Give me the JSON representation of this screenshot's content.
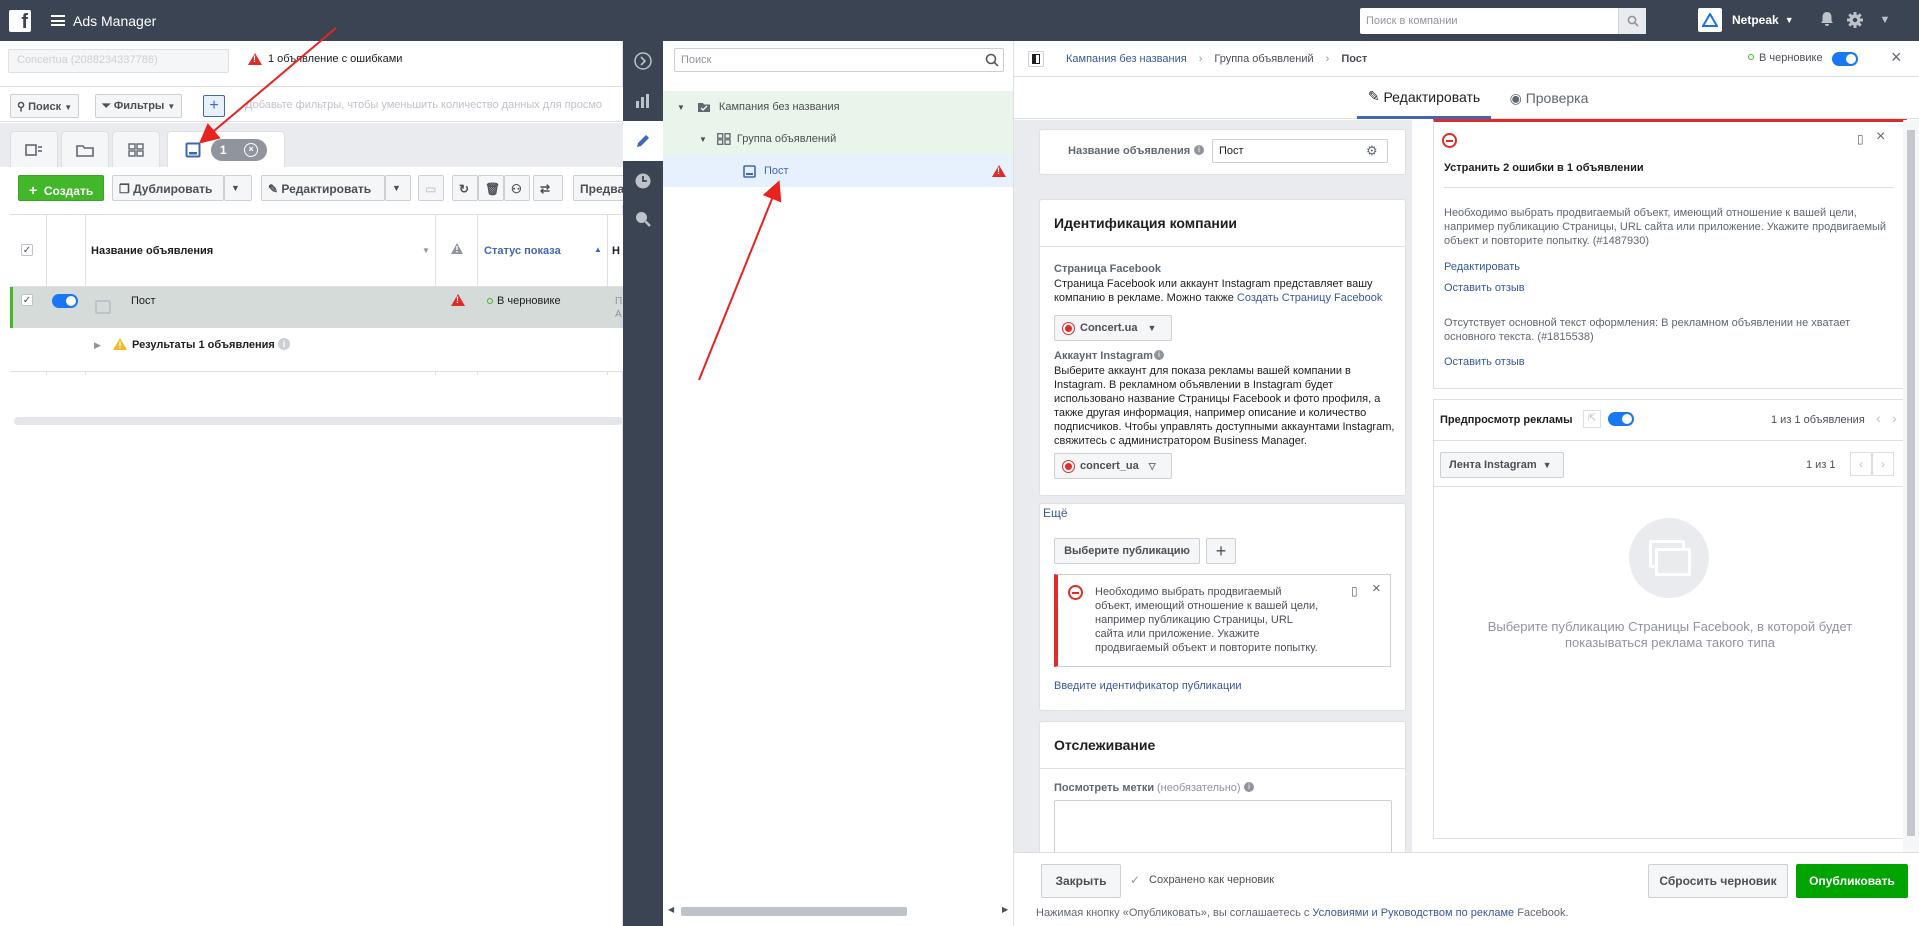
{
  "topbar": {
    "app_title": "Ads Manager",
    "search_placeholder": "Поиск в компании",
    "account_name": "Netpeak"
  },
  "left": {
    "account_selector": "Concertua (2088234337786)",
    "error_summary": "1 объявление с ошибками",
    "filters": {
      "search_label": "Поиск",
      "filters_label": "Фильтры",
      "placeholder": "Добавьте фильтры, чтобы уменьшить количество данных для просмо"
    },
    "selected_count": "1",
    "actions": {
      "create": "Создать",
      "duplicate": "Дублировать",
      "edit": "Редактировать",
      "preview": "Предва"
    },
    "table": {
      "headers": {
        "name": "Название объявления",
        "status": "Статус показа",
        "next": "Н"
      },
      "rows": [
        {
          "name": "Пост",
          "status": "В черновике",
          "next": "П А"
        }
      ],
      "results": "Результаты 1 объявления"
    }
  },
  "tree": {
    "search_placeholder": "Поиск",
    "campaign": "Кампания без названия",
    "adset": "Группа объявлений",
    "ad": "Пост"
  },
  "editor": {
    "breadcrumb": {
      "campaign": "Кампания без названия",
      "adset": "Группа объявлений",
      "ad": "Пост"
    },
    "draft_status": "В черновике",
    "tabs": {
      "edit": "Редактировать",
      "review": "Проверка"
    },
    "ad_name": {
      "label": "Название объявления",
      "value": "Пост"
    },
    "identity": {
      "title": "Идентификация компании",
      "fb_label": "Страница Facebook",
      "fb_text": "Страница Facebook или аккаунт Instagram представляет вашу компанию в рекламе. Можно также ",
      "fb_link": "Создать Страницу Facebook",
      "fb_page": "Concert.ua",
      "ig_label": "Аккаунт Instagram",
      "ig_text": "Выберите аккаунт для показа рекламы вашей компании в Instagram. В рекламном объявлении в Instagram будет использовано название Страницы Facebook и фото профиля, а также другая информация, например описание и количество подписчиков. Чтобы управлять доступными аккаунтами Instagram, свяжитесь с администратором Business Manager.",
      "ig_account": "concert_ua"
    },
    "more_link": "Ещё",
    "post": {
      "choose_button": "Выберите публикацию",
      "error": "Необходимо выбрать продвигаемый объект, имеющий отношение к вашей цели, например публикацию Страницы, URL сайта или приложение. Укажите продвигаемый объект и повторите попытку.",
      "enter_id_link": "Введите идентификатор публикации"
    },
    "tracking": {
      "title": "Отслеживание",
      "label": "Посмотреть метки",
      "optional": "(необязательно)"
    },
    "errors_panel": {
      "title": "Устранить 2 ошибки в 1 объявлении",
      "error1": "Необходимо выбрать продвигаемый объект, имеющий отношение к вашей цели, например публикацию Страницы, URL сайта или приложение. Укажите продвигаемый объект и повторите попытку. (#1487930)",
      "edit_link": "Редактировать",
      "feedback_link": "Оставить отзыв",
      "error2": "Отсутствует основной текст оформления: В рекламном объявлении не хватает основного текста. (#1815538)",
      "feedback_link2": "Оставить отзыв"
    },
    "preview": {
      "label": "Предпросмотр рекламы",
      "count": "1 из 1 объявления",
      "placement": "Лента Instagram",
      "page": "1 из 1",
      "empty_text": "Выберите публикацию Страницы Facebook, в которой будет показываться реклама такого типа"
    },
    "bottom": {
      "close": "Закрыть",
      "saved": "Сохранено как черновик",
      "discard": "Сбросить черновик",
      "publish": "Опубликовать",
      "terms_prefix": "Нажимая кнопку «Опубликовать», вы соглашаетесь с ",
      "terms_link": "Условиями и Руководством по рекламе",
      "terms_suffix": " Facebook."
    }
  },
  "colors": {
    "topbar": "#3b4452",
    "primary": "#4267b2",
    "green": "#42b72a",
    "error": "#e02b2b",
    "annotation": "#e8231f"
  }
}
